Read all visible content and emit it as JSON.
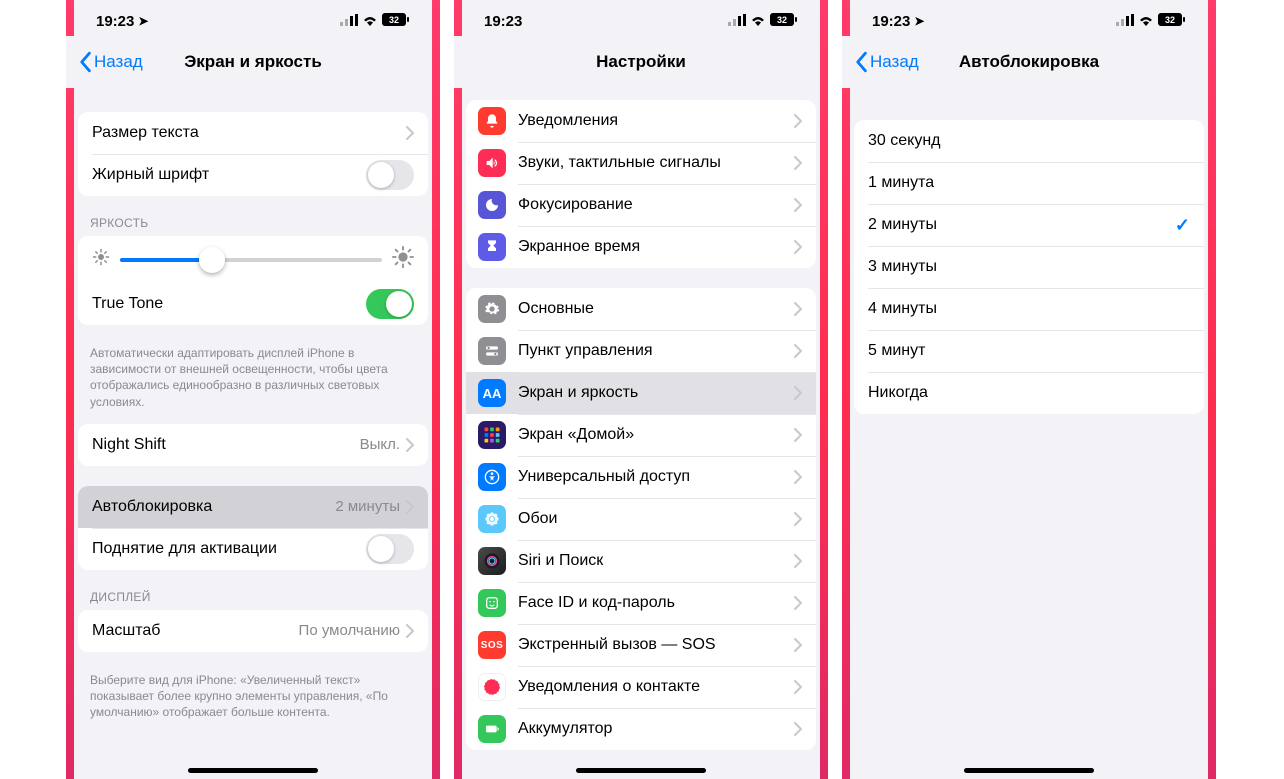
{
  "status": {
    "time": "19:23",
    "battery": "32"
  },
  "back_label": "Назад",
  "screen1": {
    "title": "Экран и яркость",
    "text_size": "Размер текста",
    "bold_text": "Жирный шрифт",
    "brightness_header": "ЯРКОСТЬ",
    "true_tone": "True Tone",
    "true_tone_footer": "Автоматически адаптировать дисплей iPhone в зависимости от внешней освещенности, чтобы цвета отображались единообразно в различных световых условиях.",
    "night_shift": "Night Shift",
    "night_shift_value": "Выкл.",
    "autolock": "Автоблокировка",
    "autolock_value": "2 минуты",
    "raise_to_wake": "Поднятие для активации",
    "display_header": "ДИСПЛЕЙ",
    "display_zoom": "Масштаб",
    "display_zoom_value": "По умолчанию",
    "display_zoom_footer": "Выберите вид для iPhone: «Увеличенный текст» показывает более крупно элементы управления, «По умолчанию» отображает больше контента."
  },
  "screen2": {
    "title": "Настройки",
    "items_a": [
      {
        "label": "Уведомления",
        "icon": "bell",
        "cls": "ic-red"
      },
      {
        "label": "Звуки, тактильные сигналы",
        "icon": "speaker",
        "cls": "ic-pink"
      },
      {
        "label": "Фокусирование",
        "icon": "moon",
        "cls": "ic-indigo"
      },
      {
        "label": "Экранное время",
        "icon": "hourglass",
        "cls": "ic-purple"
      }
    ],
    "items_b": [
      {
        "label": "Основные",
        "icon": "gear",
        "cls": "ic-gray"
      },
      {
        "label": "Пункт управления",
        "icon": "switches",
        "cls": "ic-gray"
      },
      {
        "label": "Экран и яркость",
        "icon": "aa",
        "cls": "ic-blue",
        "hl": true
      },
      {
        "label": "Экран «Домой»",
        "icon": "grid",
        "cls": "ic-grid"
      },
      {
        "label": "Универсальный доступ",
        "icon": "access",
        "cls": "ic-blue"
      },
      {
        "label": "Обои",
        "icon": "flower",
        "cls": "ic-teal"
      },
      {
        "label": "Siri и Поиск",
        "icon": "siri",
        "cls": "ic-siri"
      },
      {
        "label": "Face ID и код-пароль",
        "icon": "face",
        "cls": "ic-green"
      },
      {
        "label": "Экстренный вызов — SOS",
        "icon": "sos",
        "cls": "ic-sos"
      },
      {
        "label": "Уведомления о контакте",
        "icon": "dot",
        "cls": "ic-dot"
      },
      {
        "label": "Аккумулятор",
        "icon": "battery",
        "cls": "ic-green"
      }
    ]
  },
  "screen3": {
    "title": "Автоблокировка",
    "options": [
      {
        "label": "30 секунд"
      },
      {
        "label": "1 минута"
      },
      {
        "label": "2 минуты",
        "checked": true
      },
      {
        "label": "3 минуты"
      },
      {
        "label": "4 минуты"
      },
      {
        "label": "5 минут"
      },
      {
        "label": "Никогда"
      }
    ]
  }
}
